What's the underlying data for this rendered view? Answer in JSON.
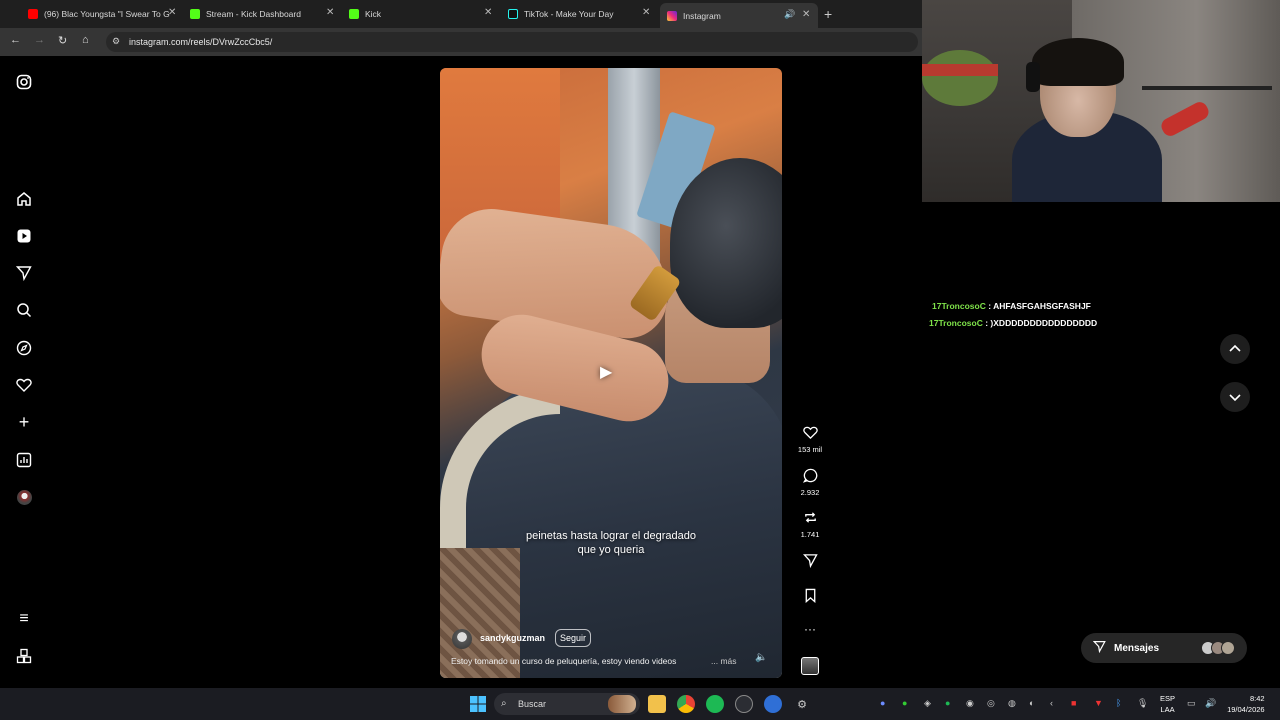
{
  "browser": {
    "tabs": [
      {
        "label": "(96) Blac Youngsta \"I Swear To G",
        "fav_color": "#ff0000"
      },
      {
        "label": "Stream - Kick Dashboard",
        "fav_color": "#53fc18"
      },
      {
        "label": "Kick",
        "fav_color": "#53fc18"
      },
      {
        "label": "TikTok - Make Your Day",
        "fav_color": "#111111"
      },
      {
        "label": "Instagram",
        "fav_color": "#e1306c"
      }
    ],
    "new_tab": "+",
    "url": "instagram.com/reels/DVrwZccCbc5/"
  },
  "reel": {
    "caption": "peinetas hasta lograr el degradado que yo queria",
    "username": "sandykguzman",
    "follow_label": "Seguir",
    "description": "Estoy tomando un curso de peluquería, estoy viendo videos",
    "more_label": "... más",
    "likes": "153 mil",
    "comments": "2.932",
    "reposts": "1.741"
  },
  "chat": [
    {
      "user": "17TroncosoC",
      "message": ": AHFASFGAHSGFASHJF"
    },
    {
      "user": "17TroncosoC",
      "message": ": )XDDDDDDDDDDDDDDDD"
    }
  ],
  "messages_label": "Mensajes",
  "taskbar": {
    "search_label": "Buscar",
    "lang_line1": "ESP",
    "lang_line2": "LAA",
    "time": "8:42",
    "date": "19/04/2026"
  },
  "colors": {
    "chat_user": "#7fe34a",
    "taskbar_bg": "#1b1c22"
  }
}
